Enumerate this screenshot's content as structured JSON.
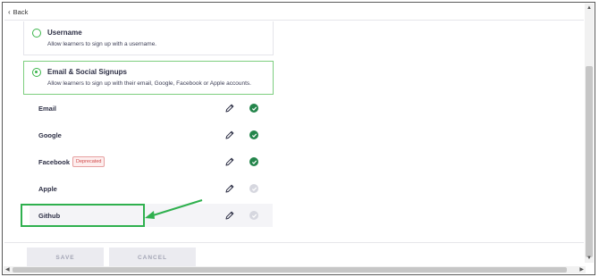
{
  "nav": {
    "back_label": "Back"
  },
  "options": [
    {
      "title": "Username",
      "description": "Allow learners to sign up with a username.",
      "selected": false
    },
    {
      "title": "Email & Social Signups",
      "description": "Allow learners to sign up with their email, Google, Facebook or Apple accounts.",
      "selected": true
    }
  ],
  "providers": [
    {
      "name": "Email",
      "badge": "",
      "enabled": true
    },
    {
      "name": "Google",
      "badge": "",
      "enabled": true
    },
    {
      "name": "Facebook",
      "badge": "Deprecated",
      "enabled": true
    },
    {
      "name": "Apple",
      "badge": "",
      "enabled": false
    },
    {
      "name": "Github",
      "badge": "",
      "enabled": false
    }
  ],
  "footer": {
    "save_label": "SAVE",
    "cancel_label": "CANCEL"
  },
  "colors": {
    "accent_green": "#3bb54a",
    "check_on": "#24854b",
    "check_off": "#d6d7df",
    "badge_red": "#d04a4a",
    "annotation_green": "#2fb04e"
  },
  "icons": {
    "edit": "pencil-icon",
    "enabled": "check-circle-icon",
    "back": "chevron-left-icon"
  }
}
